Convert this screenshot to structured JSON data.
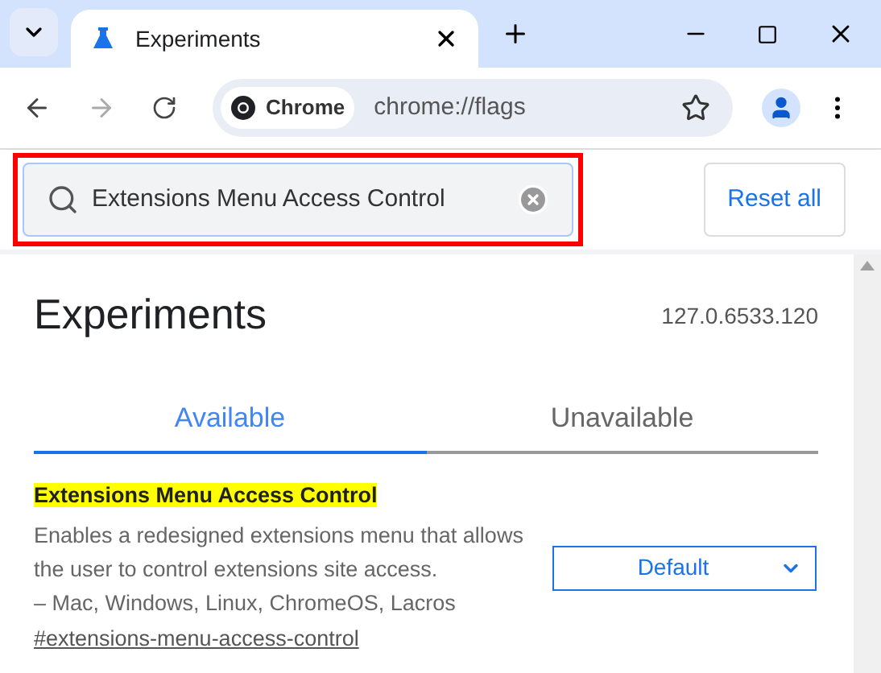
{
  "browser_tab": {
    "title": "Experiments",
    "selected": true
  },
  "address_bar": {
    "chip": "Chrome",
    "url": "chrome://flags"
  },
  "search": {
    "value": "Extensions Menu Access Control",
    "highlighted": true
  },
  "reset_button": "Reset all",
  "page": {
    "title": "Experiments",
    "version": "127.0.6533.120"
  },
  "tabs": [
    {
      "label": "Available",
      "selected": true
    },
    {
      "label": "Unavailable",
      "selected": false
    }
  ],
  "flags": [
    {
      "name": "Extensions Menu Access Control",
      "highlighted": true,
      "description": "Enables a redesigned extensions menu that allows the user to control extensions site access.",
      "platforms": "– Mac, Windows, Linux, ChromeOS, Lacros",
      "link": "#extensions-menu-access-control",
      "value": "Default"
    }
  ]
}
